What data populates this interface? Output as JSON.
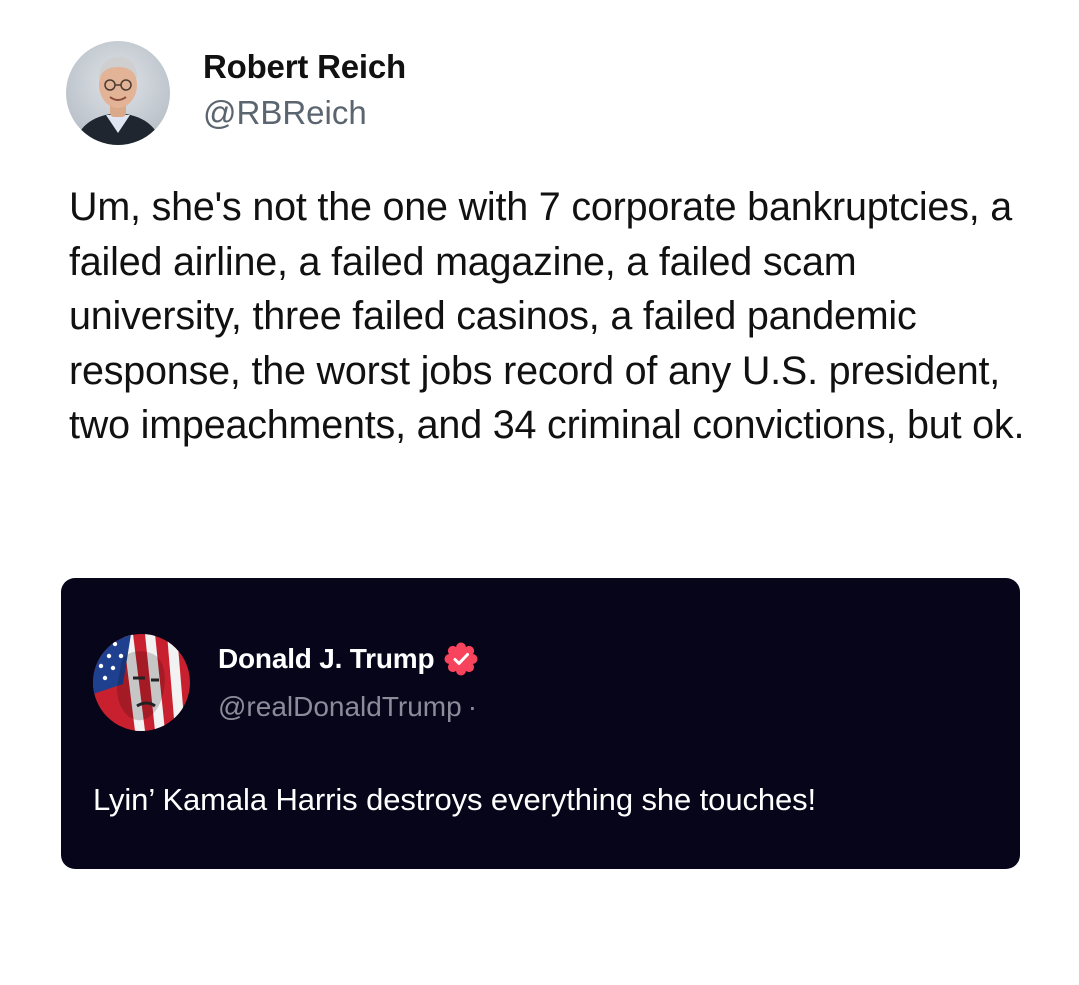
{
  "post": {
    "author": {
      "name": "Robert Reich",
      "handle": "@RBReich",
      "avatar_icon": "person-photo-avatar"
    },
    "text": "Um, she's not the one with 7 corporate bankruptcies, a failed airline, a failed magazine, a failed scam university, three failed casinos, a failed pandemic response, the worst jobs record of any U.S. president, two impeachments, and 34 criminal convictions, but ok."
  },
  "quoted_post": {
    "author": {
      "name": "Donald J. Trump",
      "handle": "@realDonaldTrump",
      "separator": "·",
      "verified_icon": "verified-badge-icon",
      "avatar_icon": "flag-portrait-avatar"
    },
    "text": "Lyin’ Kamala Harris destroys everything she touches!"
  },
  "colors": {
    "background": "#ffffff",
    "text_primary": "#111111",
    "handle_gray": "#5b6570",
    "quote_background": "#07051a",
    "quote_handle_gray": "#8a8d99",
    "verified_badge": "#f7435c"
  }
}
